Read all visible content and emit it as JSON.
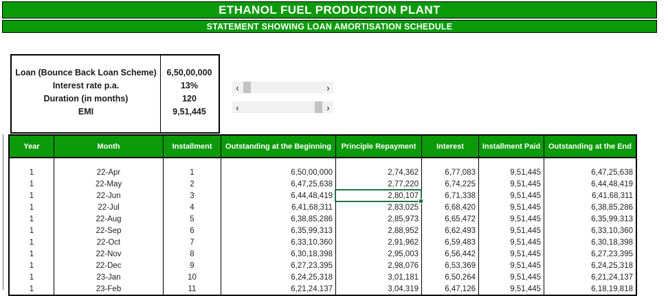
{
  "page": {
    "title": "ETHANOL FUEL PRODUCTION PLANT",
    "subtitle": "STATEMENT SHOWING LOAN AMORTISATION SCHEDULE"
  },
  "loan_summary": {
    "rows": [
      {
        "label": "Loan (Bounce Back Loan Scheme)",
        "value": "6,50,00,000"
      },
      {
        "label": "Interest rate p.a.",
        "value": "13%"
      },
      {
        "label": "Duration (in months)",
        "value": "120"
      },
      {
        "label": "EMI",
        "value": "9,51,445"
      }
    ]
  },
  "scrollbars": {
    "left_arrow_glyph": "‹",
    "right_arrow_glyph": "›"
  },
  "table": {
    "columns": [
      "Year",
      "Month",
      "Installment",
      "Outstanding at the Beginning",
      "Principle Repayment",
      "Interest",
      "Installment Paid",
      "Outstanding at the End"
    ],
    "rows": [
      [
        "1",
        "22-Apr",
        "1",
        "6,50,00,000",
        "2,74,362",
        "6,77,083",
        "9,51,445",
        "6,47,25,638"
      ],
      [
        "1",
        "22-May",
        "2",
        "6,47,25,638",
        "2,77,220",
        "6,74,225",
        "9,51,445",
        "6,44,48,419"
      ],
      [
        "1",
        "22-Jun",
        "3",
        "6,44,48,419",
        "2,80,107",
        "6,71,338",
        "9,51,445",
        "6,41,68,311"
      ],
      [
        "1",
        "22-Jul",
        "4",
        "6,41,68,311",
        "2,83,025",
        "6,68,420",
        "9,51,445",
        "6,38,85,286"
      ],
      [
        "1",
        "22-Aug",
        "5",
        "6,38,85,286",
        "2,85,973",
        "6,65,472",
        "9,51,445",
        "6,35,99,313"
      ],
      [
        "1",
        "22-Sep",
        "6",
        "6,35,99,313",
        "2,88,952",
        "6,62,493",
        "9,51,445",
        "6,33,10,360"
      ],
      [
        "1",
        "22-Oct",
        "7",
        "6,33,10,360",
        "2,91,962",
        "6,59,483",
        "9,51,445",
        "6,30,18,398"
      ],
      [
        "1",
        "22-Nov",
        "8",
        "6,30,18,398",
        "2,95,003",
        "6,56,442",
        "9,51,445",
        "6,27,23,395"
      ],
      [
        "1",
        "22-Dec",
        "9",
        "6,27,23,395",
        "2,98,076",
        "6,53,369",
        "9,51,445",
        "6,24,25,318"
      ],
      [
        "1",
        "23-Jan",
        "10",
        "6,24,25,318",
        "3,01,181",
        "6,50,264",
        "9,51,445",
        "6,21,24,137"
      ],
      [
        "1",
        "23-Feb",
        "11",
        "6,21,24,137",
        "3,04,319",
        "6,47,126",
        "9,51,445",
        "6,18,19,818"
      ]
    ],
    "selected_cell": {
      "row_month": "22-Jun",
      "column": "Principle Repayment",
      "value": "2,80,107"
    }
  },
  "colors": {
    "header_green": "#0a9a0a",
    "selection_green": "#217346",
    "scrollbar_track": "#f1f1f1",
    "scrollbar_thumb": "#c3c3c3"
  }
}
